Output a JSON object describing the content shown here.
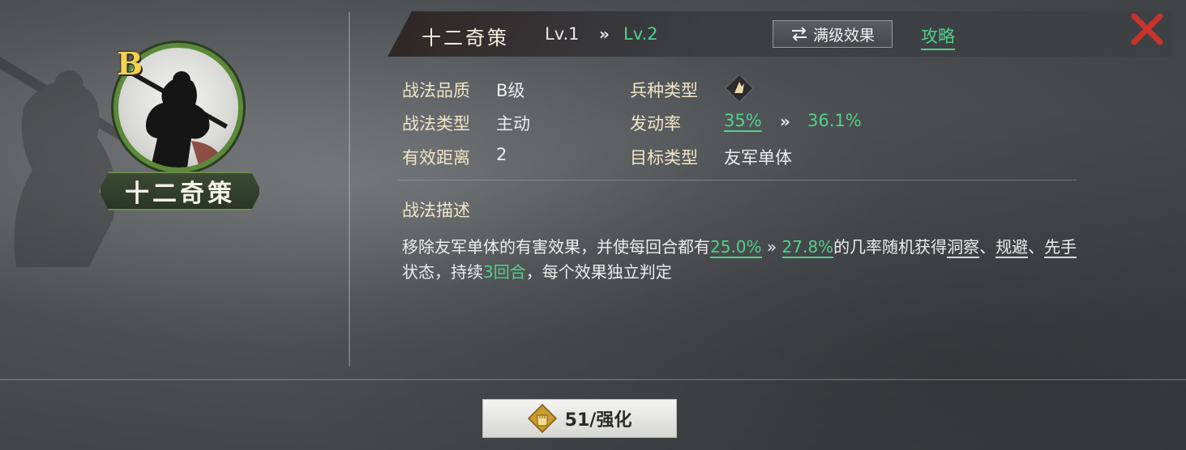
{
  "colors": {
    "accent_green": "#4fd18b",
    "label_cream": "#efe6c8",
    "close_red": "#c8332b",
    "grade_gold": "#f5d24a"
  },
  "portrait": {
    "grade": "B",
    "name": "十二奇策",
    "icon": "warrior-spear-portrait"
  },
  "header": {
    "title": "十二奇策",
    "level_from": "Lv.1",
    "level_arrow": "»",
    "level_to": "Lv.2",
    "max_effect_label": "满级效果",
    "max_effect_icon": "swap-arrows-icon",
    "guide_label": "攻略",
    "close_icon": "close-icon"
  },
  "info": {
    "quality": {
      "label": "战法品质",
      "value": "B级"
    },
    "type": {
      "label": "战法类型",
      "value": "主动"
    },
    "range": {
      "label": "有效距离",
      "value": "2"
    },
    "unit_type": {
      "label": "兵种类型",
      "icon": "troop-type-icon"
    },
    "trigger_rate": {
      "label": "发动率",
      "from": "35%",
      "arrow": "»",
      "to": "36.1%"
    },
    "target": {
      "label": "目标类型",
      "value": "友军单体"
    }
  },
  "description": {
    "title": "战法描述",
    "p1": "移除友军单体的有害效果，并使每回合都有",
    "rate_from": "25.0%",
    "arrow": "»",
    "rate_to": "27.8%",
    "p2": "的几率随机获得",
    "kw1": "洞察",
    "sep1": "、",
    "kw2": "规避",
    "sep2": "、",
    "kw3": "先手",
    "p3": "状态，持续",
    "duration": "3回合",
    "p4": "，每个效果独立判定"
  },
  "upgrade": {
    "label": "51/强化",
    "icon": "fist-token-icon"
  }
}
